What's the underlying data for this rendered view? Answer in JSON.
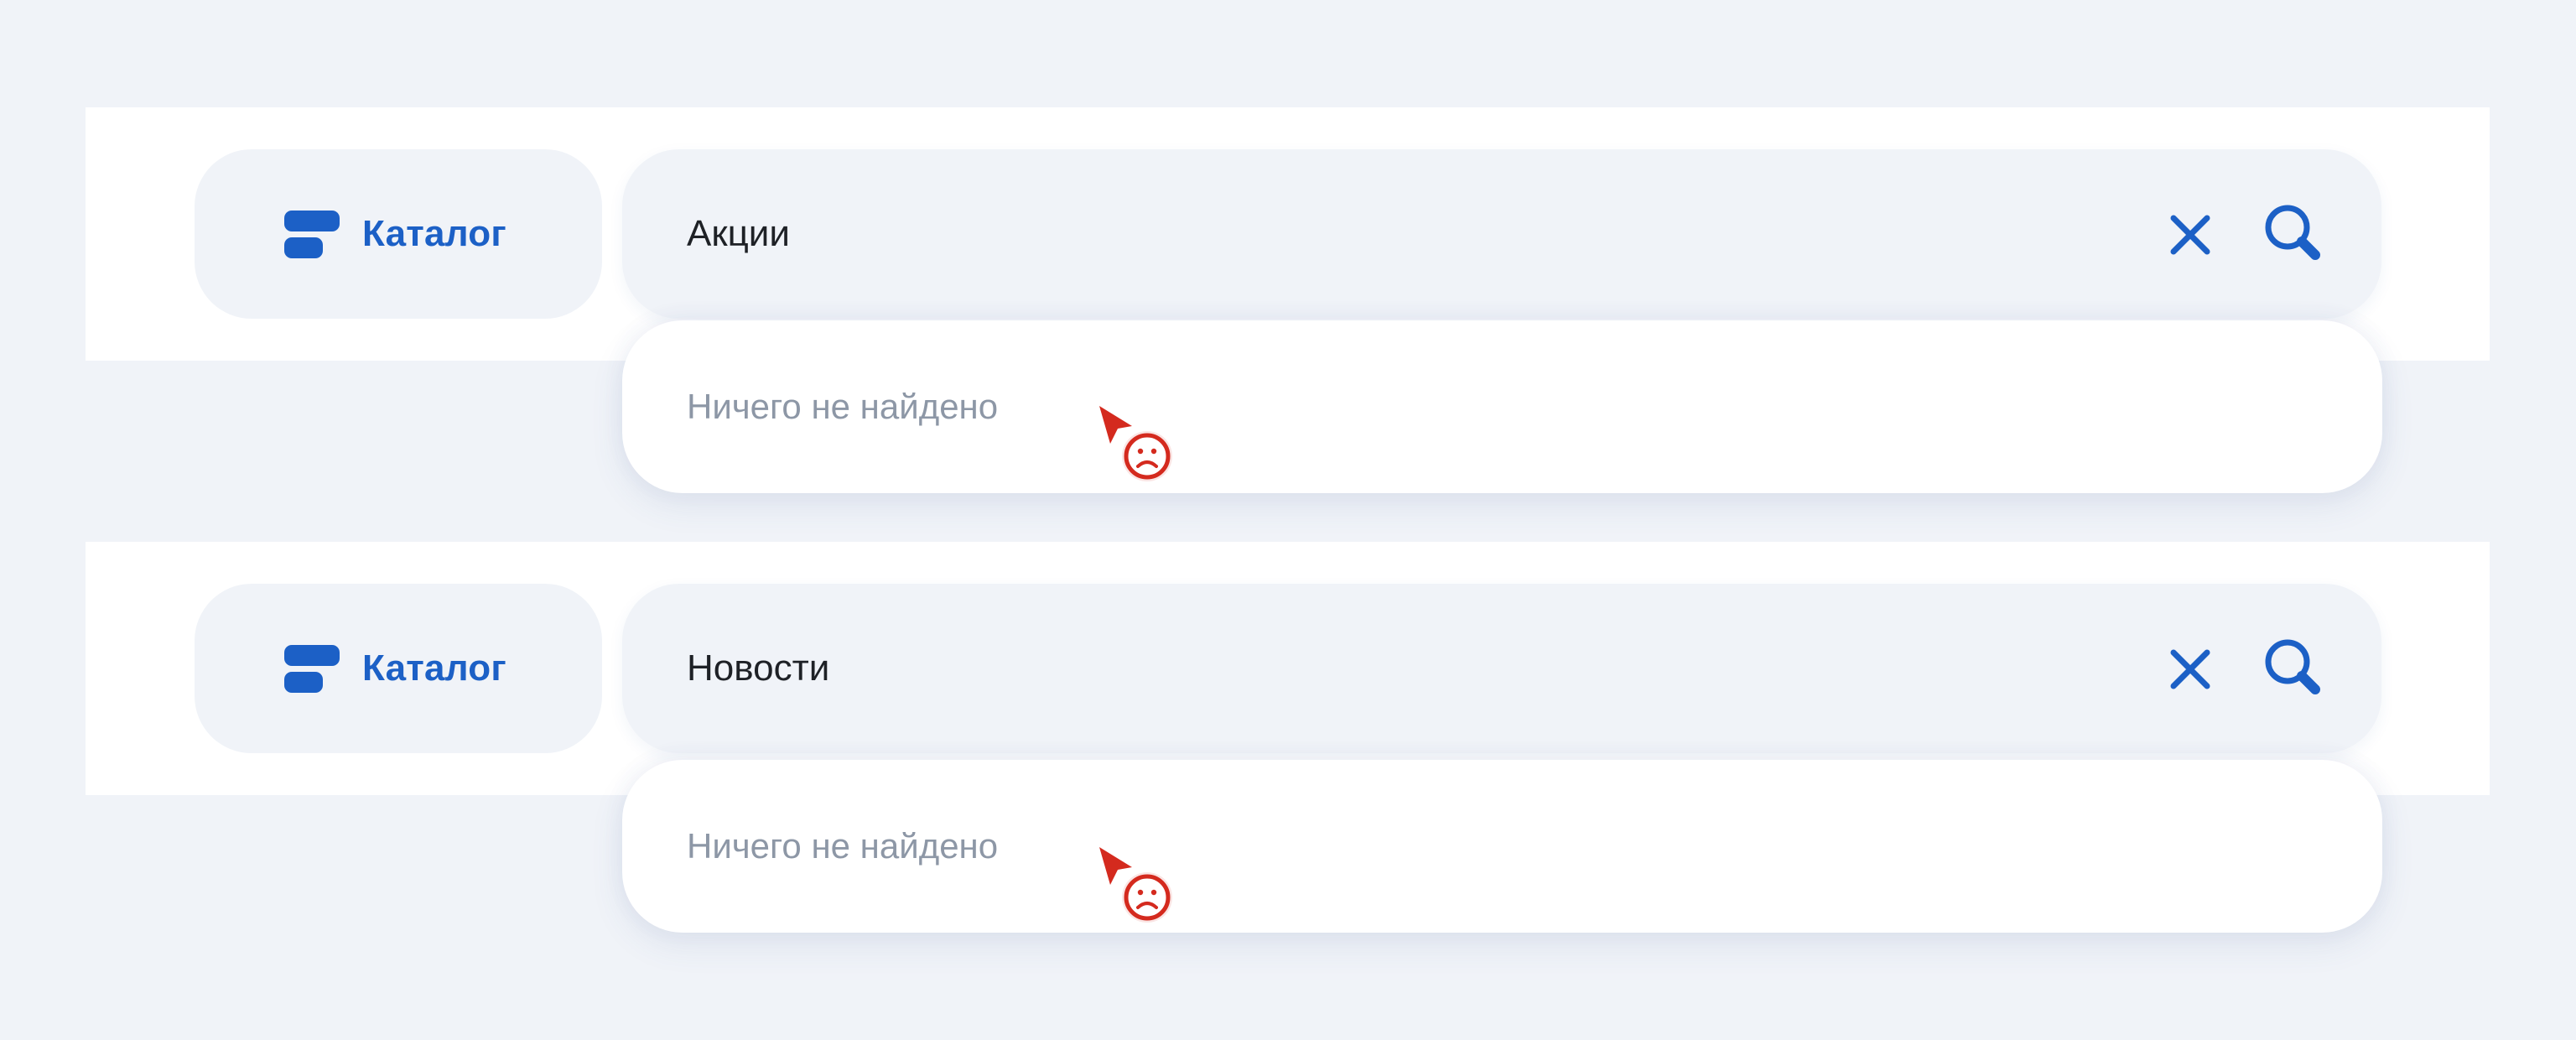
{
  "colors": {
    "accent": "#1c60c6",
    "background": "#f0f3f8",
    "muted_text": "#8d97a6",
    "cursor_red": "#d42a1e"
  },
  "rows": [
    {
      "catalog_button": {
        "label": "Каталог",
        "icon": "catalog-icon"
      },
      "search": {
        "value": "Акции",
        "clear_icon": "close-icon",
        "search_icon": "search-icon"
      },
      "dropdown": {
        "empty_text": "Ничего не найдено"
      },
      "cursor": {
        "icon": "not-allowed-cursor-icon"
      }
    },
    {
      "catalog_button": {
        "label": "Каталог",
        "icon": "catalog-icon"
      },
      "search": {
        "value": "Новости",
        "clear_icon": "close-icon",
        "search_icon": "search-icon"
      },
      "dropdown": {
        "empty_text": "Ничего не найдено"
      },
      "cursor": {
        "icon": "not-allowed-cursor-icon"
      }
    }
  ]
}
